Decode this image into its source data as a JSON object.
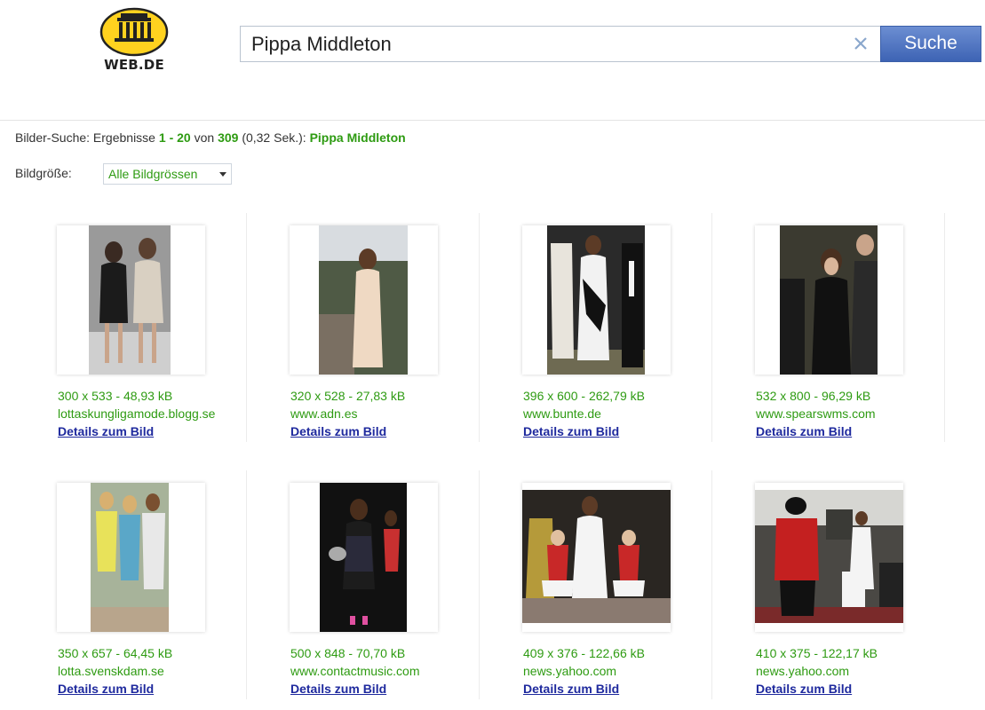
{
  "header": {
    "logo_text": "WEB.DE",
    "search_value": "Pippa Middleton",
    "search_button": "Suche"
  },
  "results": {
    "prefix": "Bilder-Suche: Ergebnisse",
    "from": "1",
    "dash": "-",
    "to": "20",
    "von": "von",
    "total": "309",
    "time": "(0,32 Sek.):",
    "query": "Pippa Middleton"
  },
  "filter": {
    "label": "Bildgröße:",
    "selected": "Alle Bildgrössen"
  },
  "colors": {
    "green": "#2e9b12",
    "link": "#1f2a9e",
    "button": "#4a6fbf"
  },
  "images": [
    {
      "size": "300 x 533 - 48,93 kB",
      "source": "lottaskungligamode.blogg.se",
      "link": "Details zum Bild"
    },
    {
      "size": "320 x 528 - 27,83 kB",
      "source": "www.adn.es",
      "link": "Details zum Bild"
    },
    {
      "size": "396 x 600 - 262,79 kB",
      "source": "www.bunte.de",
      "link": "Details zum Bild"
    },
    {
      "size": "532 x 800 - 96,29 kB",
      "source": "www.spearswms.com",
      "link": "Details zum Bild"
    },
    {
      "size": "350 x 657 - 64,45 kB",
      "source": "lotta.svenskdam.se",
      "link": "Details zum Bild"
    },
    {
      "size": "500 x 848 - 70,70 kB",
      "source": "www.contactmusic.com",
      "link": "Details zum Bild"
    },
    {
      "size": "409 x 376 - 122,66 kB",
      "source": "news.yahoo.com",
      "link": "Details zum Bild"
    },
    {
      "size": "410 x 375 - 122,17 kB",
      "source": "news.yahoo.com",
      "link": "Details zum Bild"
    }
  ]
}
